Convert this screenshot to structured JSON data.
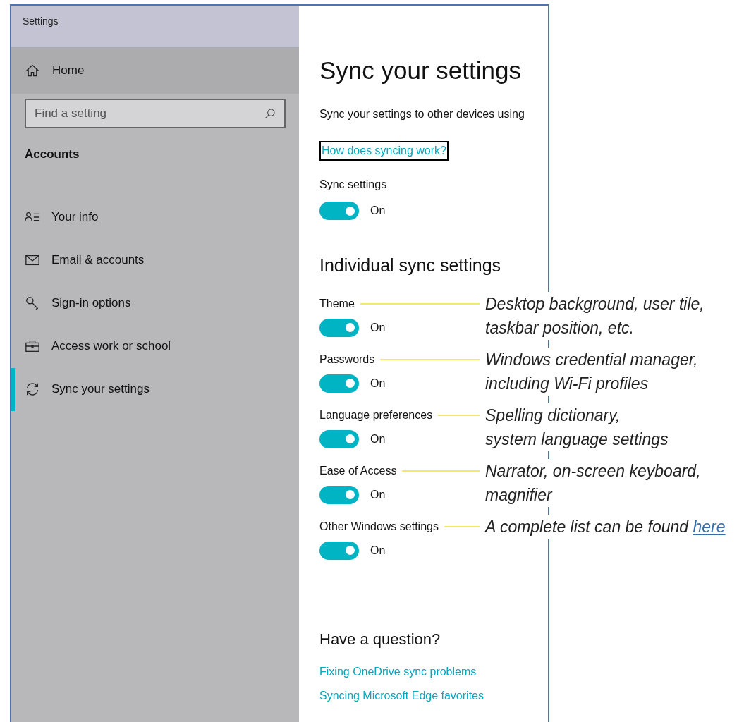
{
  "window": {
    "title": "Settings"
  },
  "sidebar": {
    "home": "Home",
    "search": {
      "placeholder": "Find a setting"
    },
    "section": "Accounts",
    "items": [
      {
        "label": "Your info",
        "kind": "person",
        "selected": false
      },
      {
        "label": "Email & accounts",
        "kind": "mail",
        "selected": false
      },
      {
        "label": "Sign-in options",
        "kind": "key",
        "selected": false
      },
      {
        "label": "Access work or school",
        "kind": "briefcase",
        "selected": false
      },
      {
        "label": "Sync your settings",
        "kind": "sync",
        "selected": true
      }
    ]
  },
  "content": {
    "title": "Sync your settings",
    "description": "Sync your settings to other devices using",
    "link": "How does syncing work?",
    "sync_settings": {
      "label": "Sync settings",
      "on": true,
      "state": "On"
    },
    "individual_heading": "Individual sync settings",
    "settings": [
      {
        "label": "Theme",
        "on": true,
        "state": "On",
        "annotation": [
          "Desktop background, user tile,",
          "taskbar position, etc."
        ]
      },
      {
        "label": "Passwords",
        "on": true,
        "state": "On",
        "annotation": [
          "Windows credential manager,",
          "including Wi-Fi profiles"
        ]
      },
      {
        "label": "Language preferences",
        "on": true,
        "state": "On",
        "annotation": [
          "Spelling dictionary,",
          "system language settings"
        ]
      },
      {
        "label": "Ease of Access",
        "on": true,
        "state": "On",
        "annotation": [
          "Narrator, on-screen keyboard,",
          "magnifier"
        ]
      },
      {
        "label": "Other Windows settings",
        "on": true,
        "state": "On",
        "annotation": [
          "A complete list can be found "
        ],
        "annotation_link": "here"
      }
    ],
    "question_heading": "Have a question?",
    "help_links": [
      "Fixing OneDrive sync problems",
      "Syncing Microsoft Edge favorites"
    ]
  }
}
